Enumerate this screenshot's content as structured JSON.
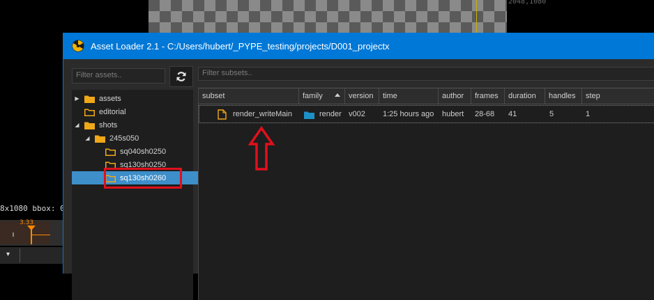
{
  "background_app": {
    "resolution_overlay": "2048,1080",
    "info_text": "8x1080  bbox: 0",
    "frame_marker": "3.33",
    "dropdown_glyph": "▾"
  },
  "window": {
    "title": "Asset Loader 2.1 - C:/Users/hubert/_PYPE_testing/projects/D001_projectx",
    "title_bar_color": "#0078d7"
  },
  "assets_panel": {
    "filter_placeholder": "Filter assets..",
    "refresh_icon": "refresh-icon",
    "tree": [
      {
        "label": "assets",
        "arrow": "▶",
        "level": 0
      },
      {
        "label": "editorial",
        "arrow": "",
        "level": 0
      },
      {
        "label": "shots",
        "arrow": "◢",
        "level": 0
      },
      {
        "label": "245s050",
        "arrow": "◢",
        "level": 1
      },
      {
        "label": "sq040sh0250",
        "arrow": "",
        "level": 2
      },
      {
        "label": "sq130sh0250",
        "arrow": "",
        "level": 2
      },
      {
        "label": "sq130sh0260",
        "arrow": "",
        "level": 2,
        "selected": true
      }
    ]
  },
  "subsets_panel": {
    "filter_placeholder": "Filter subsets..",
    "columns": [
      "subset",
      "family",
      "version",
      "time",
      "author",
      "frames",
      "duration",
      "handles",
      "step"
    ],
    "sorted_column": "family",
    "rows": [
      {
        "subset": "render_writeMain",
        "family": "render",
        "version": "v002",
        "time": "1:25 hours ago",
        "author": "hubert",
        "frames": "28-68",
        "duration": "41",
        "handles": "5",
        "step": "1"
      }
    ]
  },
  "colors": {
    "accent_selection": "#3d8ec9",
    "folder": "#f0a818",
    "family_icon": "#1e90c8",
    "annotation_red": "#e0101c"
  }
}
